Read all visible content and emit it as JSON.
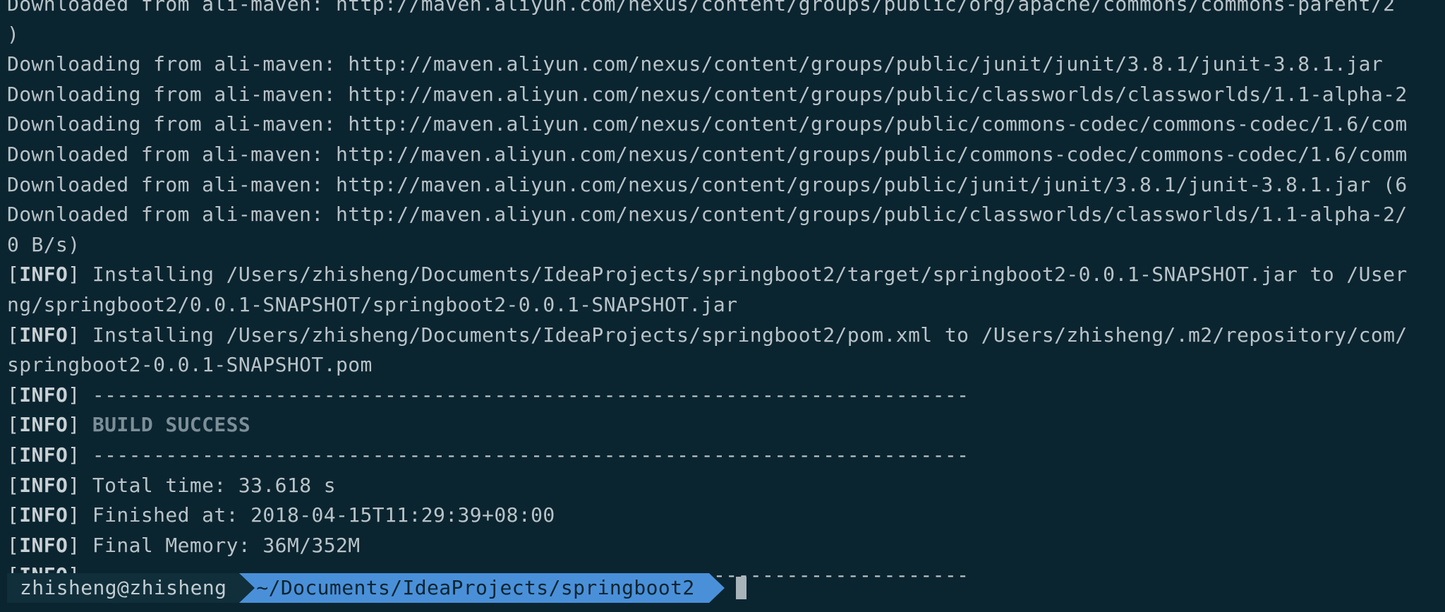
{
  "terminal": {
    "lines": [
      {
        "type": "text",
        "text": "Downloaded from ali-maven: http://maven.aliyun.com/nexus/content/groups/public/org/apache/commons/commons-parent/2"
      },
      {
        "type": "text",
        "text": ")"
      },
      {
        "type": "text",
        "text": "Downloading from ali-maven: http://maven.aliyun.com/nexus/content/groups/public/junit/junit/3.8.1/junit-3.8.1.jar"
      },
      {
        "type": "text",
        "text": "Downloading from ali-maven: http://maven.aliyun.com/nexus/content/groups/public/classworlds/classworlds/1.1-alpha-2"
      },
      {
        "type": "text",
        "text": "Downloading from ali-maven: http://maven.aliyun.com/nexus/content/groups/public/commons-codec/commons-codec/1.6/com"
      },
      {
        "type": "text",
        "text": "Downloaded from ali-maven: http://maven.aliyun.com/nexus/content/groups/public/commons-codec/commons-codec/1.6/comm"
      },
      {
        "type": "text",
        "text": "Downloaded from ali-maven: http://maven.aliyun.com/nexus/content/groups/public/junit/junit/3.8.1/junit-3.8.1.jar (6"
      },
      {
        "type": "text",
        "text": "Downloaded from ali-maven: http://maven.aliyun.com/nexus/content/groups/public/classworlds/classworlds/1.1-alpha-2/"
      },
      {
        "type": "text",
        "text": "0 B/s)"
      },
      {
        "type": "info",
        "text": " Installing /Users/zhisheng/Documents/IdeaProjects/springboot2/target/springboot2-0.0.1-SNAPSHOT.jar to /User"
      },
      {
        "type": "text",
        "text": "ng/springboot2/0.0.1-SNAPSHOT/springboot2-0.0.1-SNAPSHOT.jar"
      },
      {
        "type": "info",
        "text": " Installing /Users/zhisheng/Documents/IdeaProjects/springboot2/pom.xml to /Users/zhisheng/.m2/repository/com/"
      },
      {
        "type": "text",
        "text": "springboot2-0.0.1-SNAPSHOT.pom"
      },
      {
        "type": "info",
        "text": " ------------------------------------------------------------------------"
      },
      {
        "type": "info-success",
        "text": " BUILD SUCCESS"
      },
      {
        "type": "info",
        "text": " ------------------------------------------------------------------------"
      },
      {
        "type": "info",
        "text": " Total time: 33.618 s"
      },
      {
        "type": "info",
        "text": " Finished at: 2018-04-15T11:29:39+08:00"
      },
      {
        "type": "info",
        "text": " Final Memory: 36M/352M"
      },
      {
        "type": "info",
        "text": " ------------------------------------------------------------------------"
      }
    ],
    "info_open": "[",
    "info_word": "INFO",
    "info_close": "]"
  },
  "prompt": {
    "user_host": "zhisheng@zhisheng",
    "path": "~/Documents/IdeaProjects/springboot2"
  },
  "colors": {
    "background": "#0b2530",
    "text": "#b9c3c8",
    "path_segment": "#4a90d9",
    "user_segment": "#102f3b"
  }
}
